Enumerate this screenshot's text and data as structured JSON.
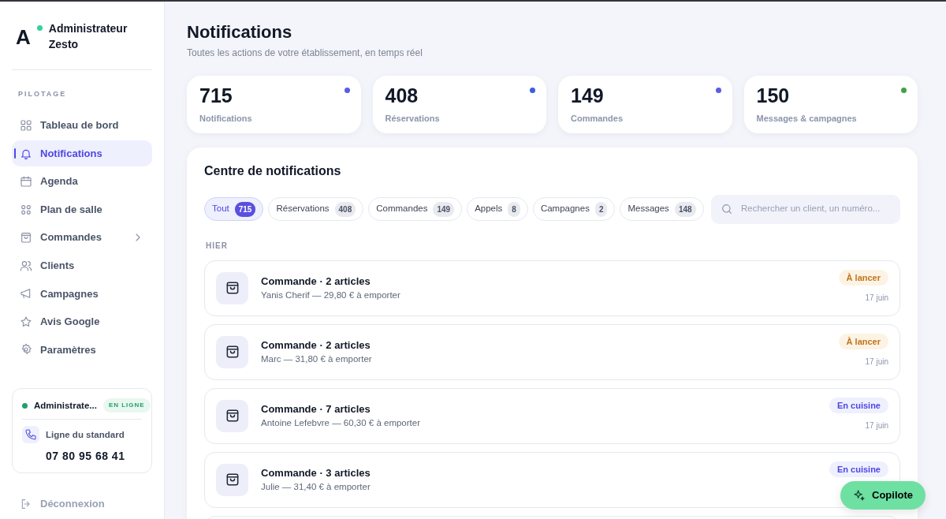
{
  "brand": {
    "logo": "A",
    "online": true,
    "name": "Administrateur Zesto"
  },
  "sidebar": {
    "section": "PILOTAGE",
    "items": [
      {
        "label": "Tableau de bord",
        "selected": false,
        "has_submenu": false
      },
      {
        "label": "Notifications",
        "selected": true,
        "has_submenu": false
      },
      {
        "label": "Agenda",
        "selected": false,
        "has_submenu": false
      },
      {
        "label": "Plan de salle",
        "selected": false,
        "has_submenu": false
      },
      {
        "label": "Commandes",
        "selected": false,
        "has_submenu": true
      },
      {
        "label": "Clients",
        "selected": false,
        "has_submenu": false
      },
      {
        "label": "Campagnes",
        "selected": false,
        "has_submenu": false
      },
      {
        "label": "Avis Google",
        "selected": false,
        "has_submenu": false
      },
      {
        "label": "Paramètres",
        "selected": false,
        "has_submenu": false
      }
    ],
    "status_card": {
      "user": "Administrate...",
      "online": true,
      "badge": "EN LIGNE",
      "line_label": "Ligne du standard",
      "phone": "07 80 95 68 41"
    },
    "logout": "Déconnexion"
  },
  "page": {
    "title": "Notifications",
    "subtitle": "Toutes les actions de votre établissement, en temps réel"
  },
  "stats": [
    {
      "value": "715",
      "label": "Notifications",
      "color": "#5b5be6"
    },
    {
      "value": "408",
      "label": "Réservations",
      "color": "#3b5de0"
    },
    {
      "value": "149",
      "label": "Commandes",
      "color": "#5b5be6"
    },
    {
      "value": "150",
      "label": "Messages & campagnes",
      "color": "#43a047"
    }
  ],
  "center": {
    "title": "Centre de notifications",
    "filters": [
      {
        "label": "Tout",
        "count": "715",
        "selected": true
      },
      {
        "label": "Réservations",
        "count": "408",
        "selected": false
      },
      {
        "label": "Commandes",
        "count": "149",
        "selected": false
      },
      {
        "label": "Appels",
        "count": "8",
        "selected": false
      },
      {
        "label": "Campagnes",
        "count": "2",
        "selected": false
      },
      {
        "label": "Messages",
        "count": "148",
        "selected": false
      }
    ],
    "search": {
      "placeholder": "Rechercher un client, un numéro..."
    },
    "group": "HIER",
    "items": [
      {
        "title": "Commande · 2 articles",
        "detail": "Yanis Cherif — 29,80 € à emporter",
        "status": "À lancer",
        "kind": "pending",
        "date": "17 juin"
      },
      {
        "title": "Commande · 2 articles",
        "detail": "Marc — 31,80 € à emporter",
        "status": "À lancer",
        "kind": "pending",
        "date": "17 juin"
      },
      {
        "title": "Commande · 7 articles",
        "detail": "Antoine Lefebvre — 60,30 € à emporter",
        "status": "En cuisine",
        "kind": "cooking",
        "date": "17 juin"
      },
      {
        "title": "Commande · 3 articles",
        "detail": "Julie — 31,40 € à emporter",
        "status": "En cuisine",
        "kind": "cooking"
      }
    ]
  },
  "copilot": "Copilote"
}
